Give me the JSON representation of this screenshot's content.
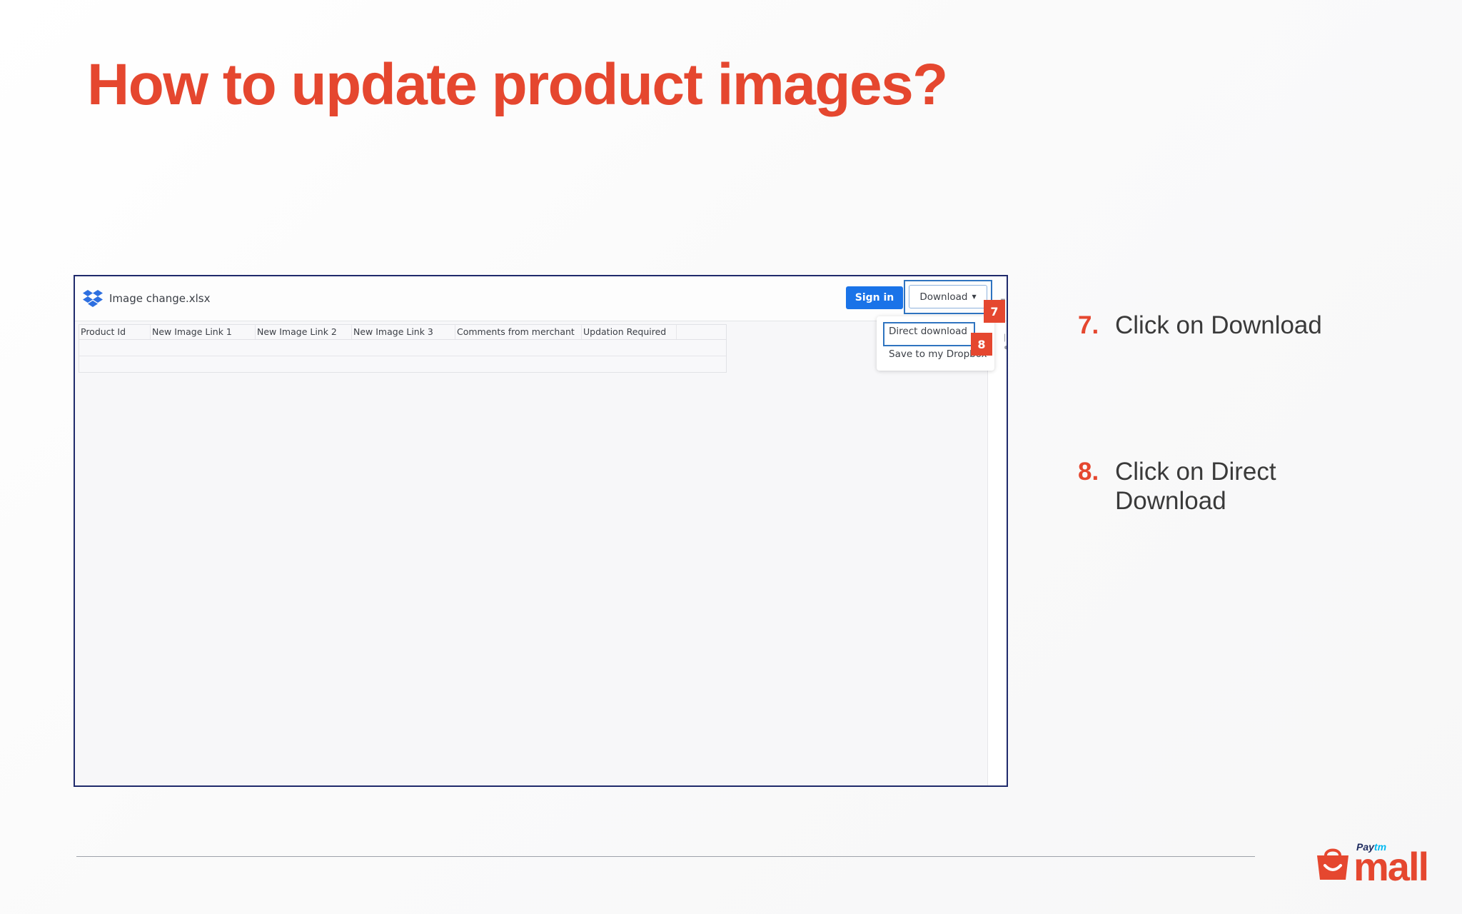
{
  "slide": {
    "title": "How to update product images?"
  },
  "screenshot": {
    "file_name": "Image change.xlsx",
    "signin_label": "Sign in",
    "download_label": "Download",
    "more_label": "...",
    "badges": {
      "step7": "7",
      "step8": "8"
    },
    "spreadsheet": {
      "columns": [
        "Product Id",
        "New Image Link 1",
        "New Image Link 2",
        "New Image Link 3",
        "Comments from merchant",
        "Updation Required",
        ""
      ]
    },
    "dropdown": {
      "items": [
        "Direct download",
        "Save to my Dropbox"
      ]
    }
  },
  "steps": [
    {
      "num": "7.",
      "text": "Click on Download"
    },
    {
      "num": "8.",
      "text": "Click on Direct Download"
    }
  ],
  "logo": {
    "paytm": "Pay",
    "paytm_tm": "tm",
    "mall": "mall"
  },
  "colors": {
    "accent": "#e5472f",
    "frame_border": "#1f2a6b",
    "signin_blue": "#1a73e8",
    "highlight_blue": "#2f74c0"
  },
  "icons": {
    "dropbox": "dropbox-icon",
    "caret": "caret-down-icon",
    "bag": "shopping-bag-icon"
  }
}
